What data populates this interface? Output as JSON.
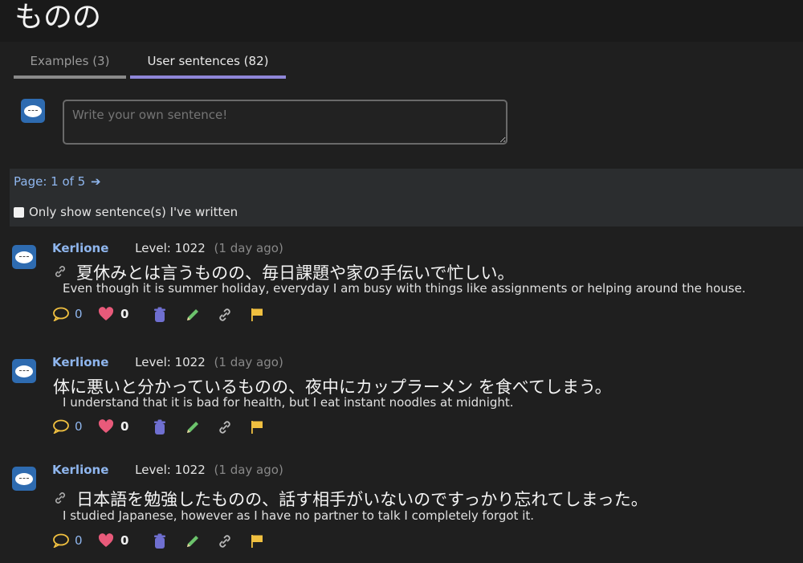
{
  "page": {
    "title": "ものの"
  },
  "tabs": [
    {
      "label": "Examples (3)"
    },
    {
      "label": "User sentences (82)"
    }
  ],
  "composer": {
    "placeholder": "Write your own sentence!"
  },
  "pager": {
    "label": "Page: 1 of 5",
    "arrow": "➔"
  },
  "filter": {
    "label": "Only show sentence(s) I've written"
  },
  "sentences": [
    {
      "user": "Kerlione",
      "level": "Level: 1022",
      "ago": "(1 day ago)",
      "japanese": "夏休みとは言うものの、毎日課題や家の手伝いで忙しい。",
      "english": "Even though it is summer holiday, everyday I am busy with things like assignments or helping around the house.",
      "comments": "0",
      "likes": "0"
    },
    {
      "user": "Kerlione",
      "level": "Level: 1022",
      "ago": "(1 day ago)",
      "japanese": "体に悪いと分かっているものの、夜中にカップラーメン を食べてしまう。",
      "english": "I understand that it is bad for health, but I eat instant noodles at midnight.",
      "comments": "0",
      "likes": "0"
    },
    {
      "user": "Kerlione",
      "level": "Level: 1022",
      "ago": "(1 day ago)",
      "japanese": "日本語を勉強したものの、話す相手がいないのですっかり忘れてしまった。",
      "english": "I studied Japanese, however as I have no partner to talk I completely forgot it.",
      "comments": "0",
      "likes": "0"
    }
  ],
  "icons": {
    "comment": "speech-bubble-icon",
    "like": "heart-icon",
    "delete": "trash-icon",
    "edit": "pencil-icon",
    "link": "chain-link-icon",
    "report": "flag-icon"
  },
  "colors": {
    "accent_blue": "#8fb6ee",
    "tab_active": "#8f86d8",
    "heart": "#e85a7a",
    "trash": "#6f6fd0",
    "pencil": "#6cc36c",
    "flag": "#f0c040"
  }
}
